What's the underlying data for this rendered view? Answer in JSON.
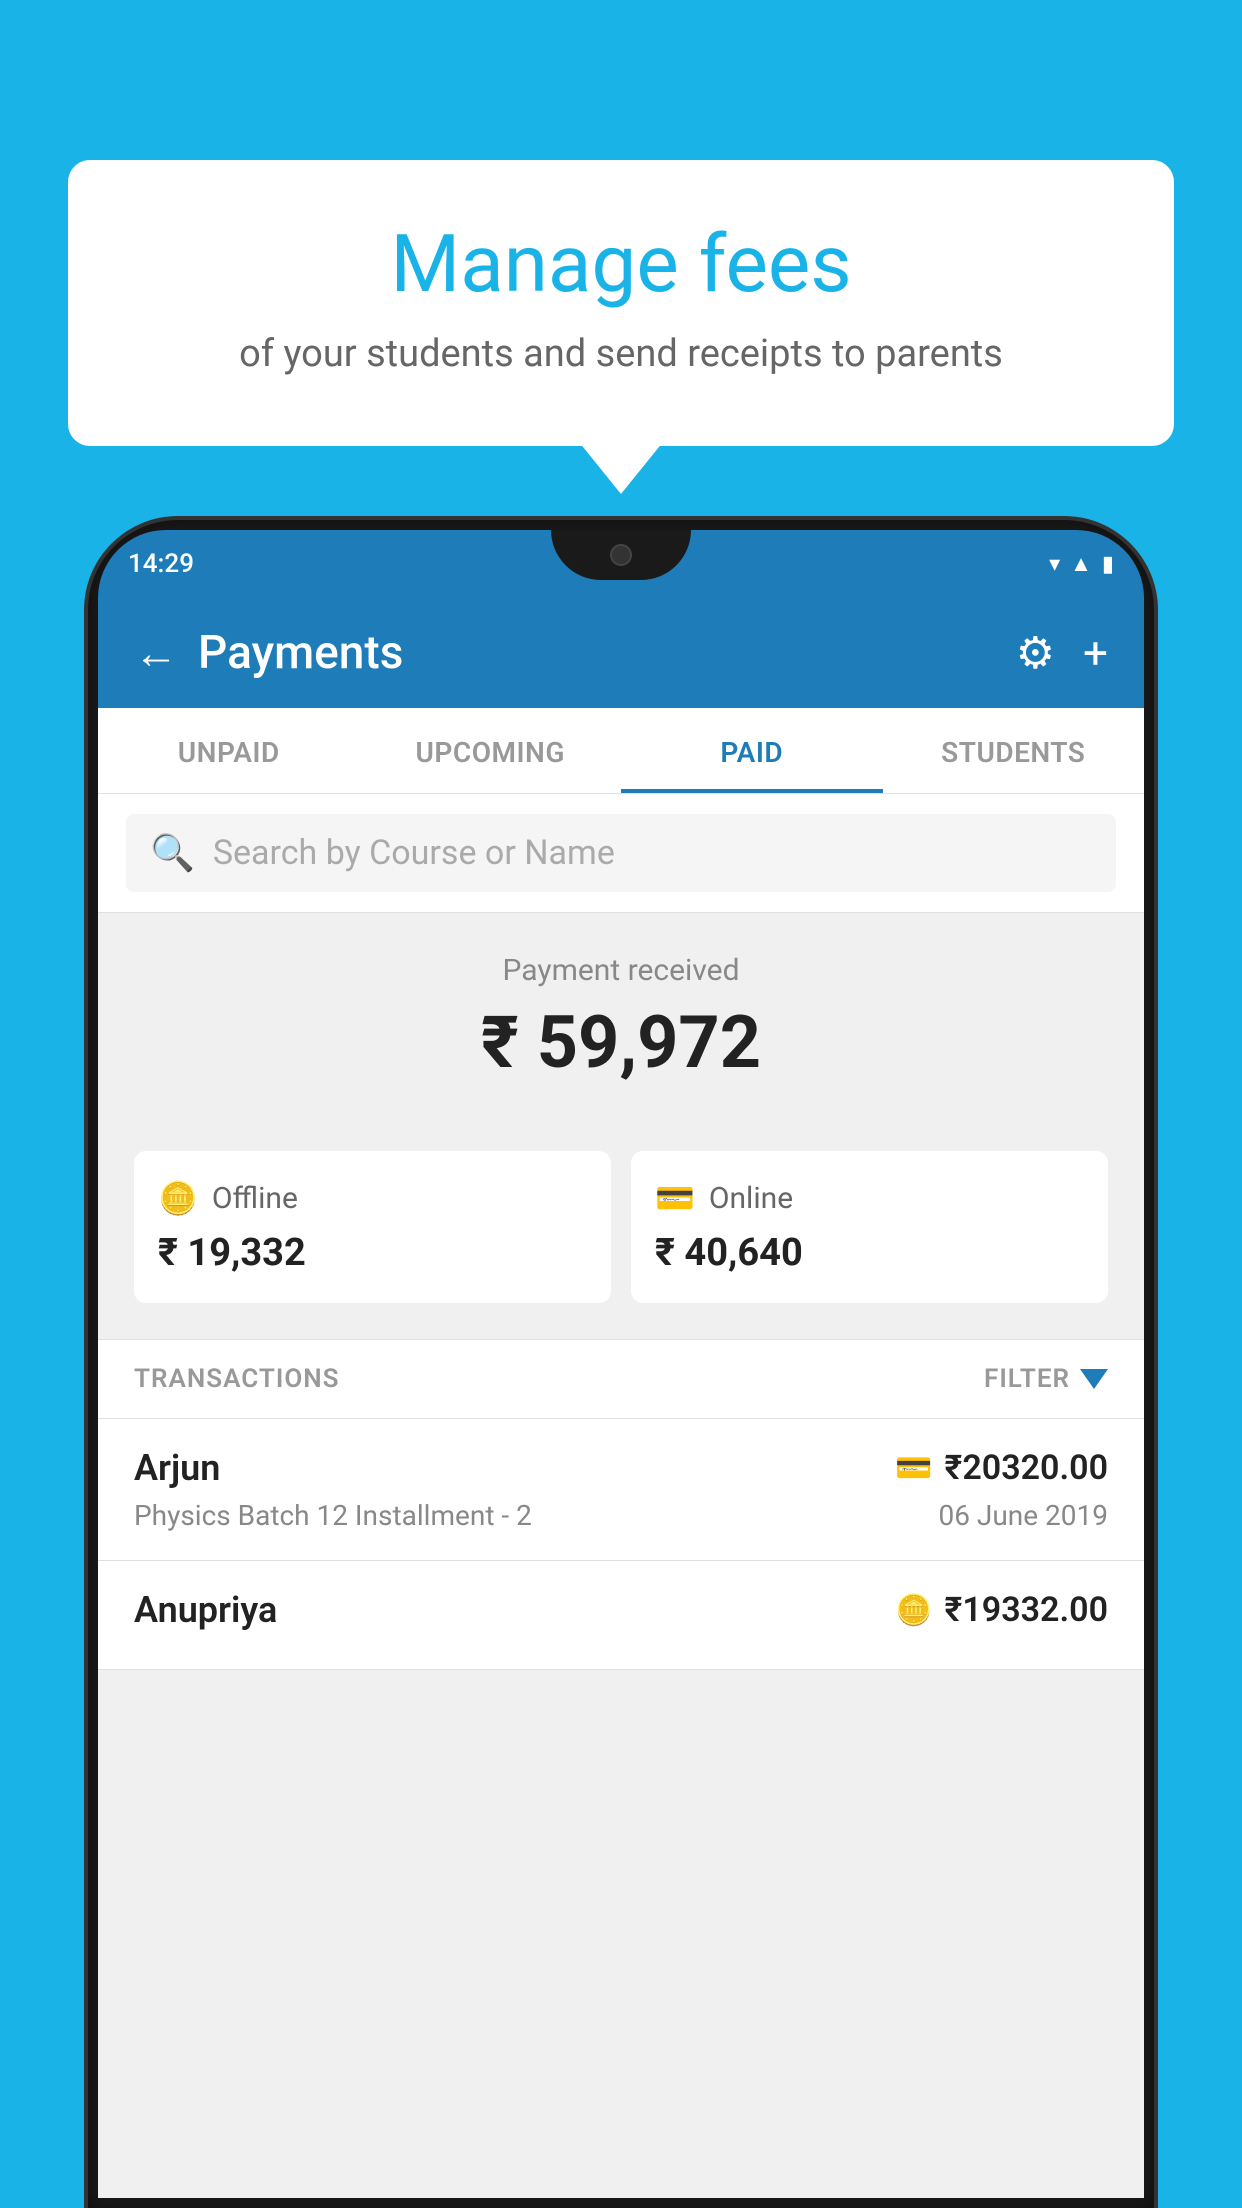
{
  "background_color": "#1ab3e8",
  "tooltip": {
    "title": "Manage fees",
    "subtitle": "of your students and send receipts to parents"
  },
  "status_bar": {
    "time": "14:29",
    "icons": [
      "wifi",
      "signal",
      "battery"
    ]
  },
  "header": {
    "back_label": "←",
    "title": "Payments",
    "settings_icon": "⚙",
    "add_icon": "+"
  },
  "tabs": [
    {
      "label": "UNPAID",
      "active": false
    },
    {
      "label": "UPCOMING",
      "active": false
    },
    {
      "label": "PAID",
      "active": true
    },
    {
      "label": "STUDENTS",
      "active": false
    }
  ],
  "search": {
    "placeholder": "Search by Course or Name"
  },
  "payment_summary": {
    "label": "Payment received",
    "total": "₹ 59,972",
    "offline_label": "Offline",
    "offline_amount": "₹ 19,332",
    "online_label": "Online",
    "online_amount": "₹ 40,640"
  },
  "transactions_section": {
    "label": "TRANSACTIONS",
    "filter_label": "FILTER"
  },
  "transactions": [
    {
      "name": "Arjun",
      "amount": "₹20320.00",
      "payment_type": "online",
      "course": "Physics Batch 12 Installment - 2",
      "date": "06 June 2019"
    },
    {
      "name": "Anupriya",
      "amount": "₹19332.00",
      "payment_type": "offline",
      "course": "",
      "date": ""
    }
  ]
}
